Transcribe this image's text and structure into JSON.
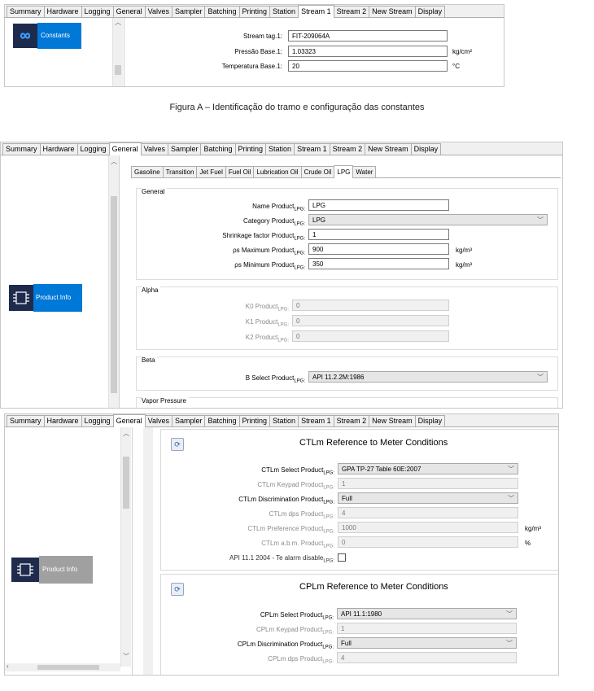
{
  "tabs": [
    "Summary",
    "Hardware",
    "Logging",
    "General",
    "Valves",
    "Sampler",
    "Batching",
    "Printing",
    "Station",
    "Stream 1",
    "Stream 2",
    "New Stream",
    "Display"
  ],
  "panel_a": {
    "active_tab": "Stream 1",
    "nav_label": "Constants",
    "fields": [
      {
        "label": "Stream tag.1:",
        "value": "FIT-209064A",
        "unit": ""
      },
      {
        "label": "Pressão Base.1:",
        "value": "1.03323",
        "unit": "kg/cm²"
      },
      {
        "label": "Temperatura Base.1:",
        "value": "20",
        "unit": "°C"
      }
    ]
  },
  "caption": "Figura A – Identificação do tramo e configuração das constantes",
  "panel_b": {
    "active_tab": "General",
    "nav_label": "Product Info",
    "product_tabs": [
      "Gasoline",
      "Transition",
      "Jet Fuel",
      "Fuel Oil",
      "Lubrication Oil",
      "Crude Oil",
      "LPG",
      "Water"
    ],
    "active_product_tab": "LPG",
    "general": {
      "title": "General",
      "name_label": "Name Product",
      "name_value": "LPG",
      "category_label": "Category Product",
      "category_value": "LPG",
      "shrinkage_label": "Shrinkage factor Product",
      "shrinkage_value": "1",
      "max_label": "ρs Maximum Product",
      "max_value": "900",
      "min_label": "ρs Minimum Product",
      "min_value": "350",
      "density_unit": "kg/m³"
    },
    "alpha": {
      "title": "Alpha",
      "k0_label": "K0 Product",
      "k0_value": "0",
      "k1_label": "K1 Product",
      "k1_value": "0",
      "k2_label": "K2 Product",
      "k2_value": "0"
    },
    "beta": {
      "title": "Beta",
      "select_label": "B Select Product",
      "select_value": "API 11.2.2M:1986"
    },
    "vapor": {
      "title": "Vapor Pressure"
    }
  },
  "panel_c": {
    "active_tab": "General",
    "nav_label": "Product Info",
    "ctl": {
      "title": "CTLm Reference to Meter Conditions",
      "select_label": "CTLm Select Product",
      "select_value": "GPA TP-27 Table 60E:2007",
      "keypad_label": "CTLm Keypad Product",
      "keypad_value": "1",
      "disc_label": "CTLm Discrimination Product",
      "disc_value": "Full",
      "dps_label": "CTLm dps Product",
      "dps_value": "4",
      "ref_label": "CTLm Preference Product",
      "ref_value": "1000",
      "ref_unit": "kg/m³",
      "abm_label": "CTLm a.b.m. Product",
      "abm_value": "0",
      "abm_unit": "%",
      "alarm_label": "API 11.1 2004 - Te alarm disable"
    },
    "cpl": {
      "title": "CPLm Reference to Meter Conditions",
      "select_label": "CPLm Select Product",
      "select_value": "API 11.1:1980",
      "keypad_label": "CPLm Keypad Product",
      "keypad_value": "1",
      "disc_label": "CPLm Discrimination Product",
      "disc_value": "Full",
      "dps_label": "CPLm dps Product",
      "dps_value": "4"
    },
    "subscript": "LPG:"
  },
  "colors": {
    "accent": "#0078d7",
    "icon_bg": "#1f2b4d",
    "disabled_nav": "#a0a0a0"
  }
}
